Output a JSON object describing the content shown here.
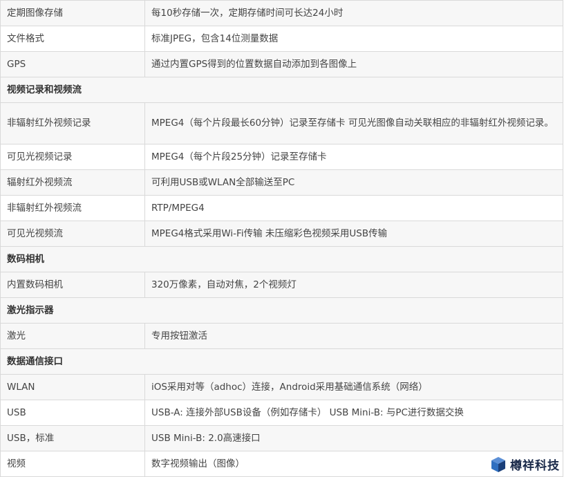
{
  "rows": [
    {
      "type": "data",
      "label": "定期图像存储",
      "value": "每10秒存储一次，定期存储时间可长达24小时"
    },
    {
      "type": "data",
      "label": "文件格式",
      "value": "标准JPEG，包含14位测量数据"
    },
    {
      "type": "data",
      "label": "GPS",
      "value": "通过内置GPS得到的位置数据自动添加到各图像上"
    },
    {
      "type": "section",
      "label": "视频记录和视频流"
    },
    {
      "type": "data",
      "label": "非辐射红外视频记录",
      "value": "MPEG4（每个片段最长60分钟）记录至存储卡 可见光图像自动关联相应的非辐射红外视频记录。"
    },
    {
      "type": "data",
      "label": "可见光视频记录",
      "value": "MPEG4（每个片段25分钟）记录至存储卡"
    },
    {
      "type": "data",
      "label": "辐射红外视频流",
      "value": "可利用USB或WLAN全部输送至PC"
    },
    {
      "type": "data",
      "label": "非辐射红外视频流",
      "value": "RTP/MPEG4"
    },
    {
      "type": "data",
      "label": "可见光视频流",
      "value": "MPEG4格式采用Wi-Fi传输 未压缩彩色视频采用USB传输"
    },
    {
      "type": "section",
      "label": "数码相机"
    },
    {
      "type": "data",
      "label": "内置数码相机",
      "value": "320万像素，自动对焦，2个视频灯"
    },
    {
      "type": "section",
      "label": "激光指示器"
    },
    {
      "type": "data",
      "label": "激光",
      "value": "专用按钮激活"
    },
    {
      "type": "section",
      "label": "数据通信接口"
    },
    {
      "type": "data",
      "label": "WLAN",
      "value": "iOS采用对等（adhoc）连接，Android采用基础通信系统（网络）"
    },
    {
      "type": "data",
      "label": "USB",
      "value": "USB-A: 连接外部USB设备（例如存储卡） USB Mini-B: 与PC进行数据交换"
    },
    {
      "type": "data",
      "label": "USB，标准",
      "value": "USB Mini-B: 2.0高速接口"
    },
    {
      "type": "data",
      "label": "视频",
      "value": "数字视频输出（图像）"
    }
  ],
  "watermark": {
    "text": "樽祥科技",
    "icon": "cube-logo-icon",
    "color": "#1a2a4a",
    "accent": "#2f6fc0"
  }
}
